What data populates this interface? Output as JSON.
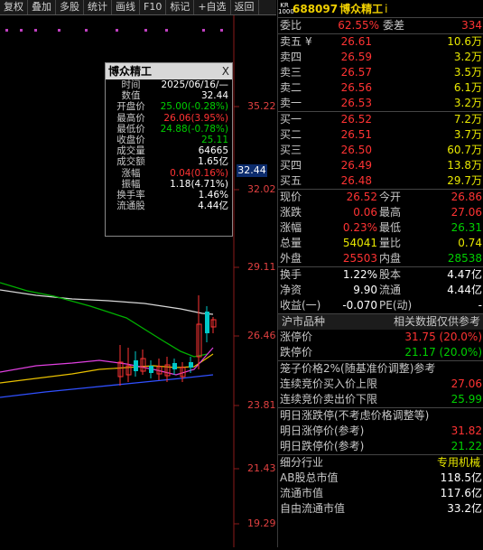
{
  "toolbar": [
    "复权",
    "叠加",
    "多股",
    "统计",
    "画线",
    "F10",
    "标记",
    "+自选",
    "返回"
  ],
  "axis": {
    "labels": [
      "35.22",
      "32.02",
      "29.11",
      "26.46",
      "23.81",
      "21.43",
      "19.29"
    ],
    "highlight": "32.44"
  },
  "tooltip": {
    "title": "博众精工",
    "close": "X",
    "rows": [
      {
        "label": "时间",
        "value": "2025/06/16/—"
      },
      {
        "label": "数值",
        "value": "32.44"
      },
      {
        "label": "开盘价",
        "value": "25.00(-0.28%)"
      },
      {
        "label": "最高价",
        "value": "26.06(3.95%)"
      },
      {
        "label": "最低价",
        "value": "24.88(-0.78%)"
      },
      {
        "label": "收盘价",
        "value": "25.11"
      },
      {
        "label": "成交量",
        "value": "64665"
      },
      {
        "label": "成交额",
        "value": "1.65亿"
      },
      {
        "label": "涨幅",
        "value": "0.04(0.16%)"
      },
      {
        "label": "振幅",
        "value": "1.18(4.71%)"
      },
      {
        "label": "换手率",
        "value": "1.46%"
      },
      {
        "label": "流通股",
        "value": "4.44亿"
      }
    ]
  },
  "stock": {
    "market": "KR",
    "board": "1000",
    "code": "688097",
    "name": "博众精工",
    "info": "i"
  },
  "weibi": {
    "label1": "委比",
    "v1": "62.55%",
    "label2": "委差",
    "v2": "334"
  },
  "asks": [
    {
      "label": "卖五",
      "mark": "¥",
      "price": "26.61",
      "vol": "10.6万"
    },
    {
      "label": "卖四",
      "mark": "",
      "price": "26.59",
      "vol": "3.2万"
    },
    {
      "label": "卖三",
      "mark": "",
      "price": "26.57",
      "vol": "3.5万"
    },
    {
      "label": "卖二",
      "mark": "",
      "price": "26.56",
      "vol": "6.1万"
    },
    {
      "label": "卖一",
      "mark": "",
      "price": "26.53",
      "vol": "3.2万"
    }
  ],
  "bids": [
    {
      "label": "买一",
      "price": "26.52",
      "vol": "7.2万"
    },
    {
      "label": "买二",
      "price": "26.51",
      "vol": "3.7万"
    },
    {
      "label": "买三",
      "price": "26.50",
      "vol": "60.7万"
    },
    {
      "label": "买四",
      "price": "26.49",
      "vol": "13.8万"
    },
    {
      "label": "买五",
      "price": "26.48",
      "vol": "29.7万"
    }
  ],
  "quote": [
    {
      "l1": "现价",
      "v1": "26.52",
      "l2": "今开",
      "v2": "26.86"
    },
    {
      "l1": "涨跌",
      "v1": "0.06",
      "l2": "最高",
      "v2": "27.06"
    },
    {
      "l1": "涨幅",
      "v1": "0.23%",
      "l2": "最低",
      "v2": "26.31"
    },
    {
      "l1": "总量",
      "v1": "54041",
      "l2": "量比",
      "v2": "0.74"
    },
    {
      "l1": "外盘",
      "v1": "25503",
      "l2": "内盘",
      "v2": "28538"
    }
  ],
  "fund": [
    {
      "l1": "换手",
      "v1": "1.22%",
      "l2": "股本",
      "v2": "4.47亿"
    },
    {
      "l1": "净资",
      "v1": "9.90",
      "l2": "流通",
      "v2": "4.44亿"
    },
    {
      "l1": "收益(一)",
      "v1": "-0.070",
      "l2": "PE(动)",
      "v2": "-"
    }
  ],
  "hsz": {
    "left": "沪市品种",
    "right": "相关数据仅供参考"
  },
  "limit": [
    {
      "label": "涨停价",
      "value": "31.75 (20.0%)"
    },
    {
      "label": "跌停价",
      "value": "21.17 (20.0%)"
    }
  ],
  "cage": {
    "head": "笼子价格2%(随基准价调整)参考",
    "rows": [
      {
        "label": "连续竞价买入价上限",
        "value": "27.06"
      },
      {
        "label": "连续竞价卖出价下限",
        "value": "25.99"
      }
    ]
  },
  "nextday": {
    "head": "明日涨跌停(不考虑价格调整等)",
    "rows": [
      {
        "label": "明日涨停价(参考)",
        "value": "31.82"
      },
      {
        "label": "明日跌停价(参考)",
        "value": "21.22"
      }
    ]
  },
  "industry": {
    "label": "细分行业",
    "value": "专用机械"
  },
  "caps": [
    {
      "label": "AB股总市值",
      "value": "118.5亿"
    },
    {
      "label": "流通市值",
      "value": "117.6亿"
    },
    {
      "label": "自由流通市值",
      "value": "33.2亿"
    }
  ]
}
